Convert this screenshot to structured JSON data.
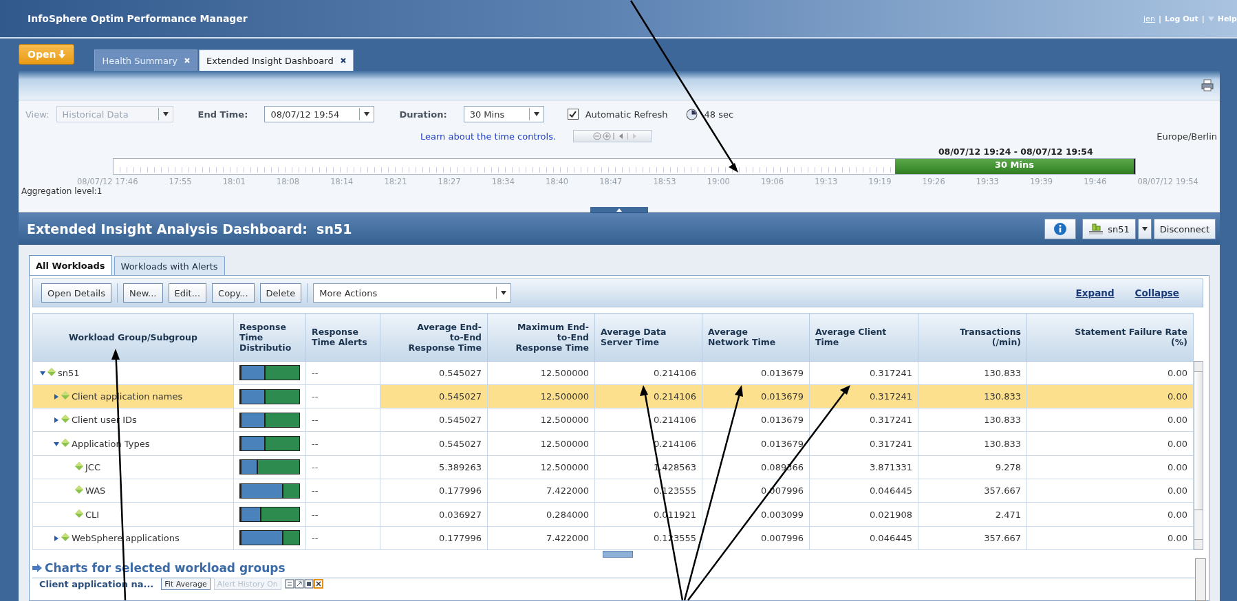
{
  "app": {
    "title": "InfoSphere Optim Performance Manager",
    "user": "jen",
    "links": [
      {
        "separator": "|",
        "label": "Log Out"
      },
      {
        "separator": "|",
        "label": "Help"
      }
    ]
  },
  "open_button": "Open",
  "tabs": [
    {
      "label": "Health Summary",
      "selected": false
    },
    {
      "label": "Extended Insight Dashboard",
      "selected": true
    }
  ],
  "time_controls": {
    "view_label": "View:",
    "view_value": "Historical Data",
    "view_disabled": true,
    "end_time_label": "End Time:",
    "end_time": "08/07/12 19:54",
    "duration_label": "Duration:",
    "duration": "30 Mins",
    "auto_refresh": {
      "label": "Automatic Refresh",
      "checked": true
    },
    "refresh_countdown": "48 sec",
    "help_link": "Learn about the time controls.",
    "timezone": "Europe/Berlin",
    "range": "08/07/12 19:24 - 08/07/12 19:54",
    "selection": {
      "label": "30 Mins",
      "level": 0.235
    },
    "ticks": [
      "08/07/12 17:46",
      "17:55",
      "18:01",
      "18:08",
      "18:14",
      "18:21",
      "18:27",
      "18:34",
      "18:40",
      "18:47",
      "18:53",
      "19:00",
      "19:06",
      "19:13",
      "19:19",
      "19:26",
      "19:33",
      "19:39",
      "19:46",
      "08/07/12 19:54"
    ],
    "aggregation": "Aggregation level:1"
  },
  "dashboard": {
    "title": "Extended Insight Analysis Dashboard:  sn51",
    "database": "sn51",
    "disconnect": "Disconnect"
  },
  "workload_tabs": [
    {
      "label": "All Workloads",
      "selected": true
    },
    {
      "label": "Workloads with Alerts",
      "selected": false
    }
  ],
  "toolbar": {
    "buttons": [
      "Open Details",
      "New...",
      "Edit...",
      "Copy...",
      "Delete"
    ],
    "more_actions": "More Actions",
    "links": [
      "Expand",
      "Collapse"
    ]
  },
  "table": {
    "columns": [
      "Workload Group/Subgroup",
      "Response Time Distributio",
      "Response Time Alerts",
      "Average End-to-End Response Time",
      "Maximum End-to-End Response Time",
      "Average Data Server Time",
      "Average Network Time",
      "Average Client Time",
      "Transactions (/min)",
      "Statement Failure Rate (%)"
    ],
    "rows": [
      {
        "name": "sn51",
        "expanded": true,
        "selected": false,
        "distribution": {
          "level": 0.42
        },
        "alerts": "--",
        "values": [
          "0.545027",
          "12.500000",
          "0.214106",
          "0.013679",
          "0.317241",
          "130.833",
          "0.00"
        ],
        "children": [
          {
            "name": "Client application names",
            "expanded": false,
            "selected": true,
            "distribution": {
              "level": 0.42
            },
            "alerts": "--",
            "values": [
              "0.545027",
              "12.500000",
              "0.214106",
              "0.013679",
              "0.317241",
              "130.833",
              "0.00"
            ]
          },
          {
            "name": "Client user IDs",
            "expanded": false,
            "selected": false,
            "distribution": {
              "level": 0.42
            },
            "alerts": "--",
            "values": [
              "0.545027",
              "12.500000",
              "0.214106",
              "0.013679",
              "0.317241",
              "130.833",
              "0.00"
            ]
          },
          {
            "name": "Application Types",
            "expanded": true,
            "selected": false,
            "distribution": {
              "level": 0.42
            },
            "alerts": "--",
            "values": [
              "0.545027",
              "12.500000",
              "0.214106",
              "0.013679",
              "0.317241",
              "130.833",
              "0.00"
            ],
            "children": [
              {
                "name": "JCC",
                "selected": false,
                "distribution": {
                  "level": 0.28
                },
                "alerts": "--",
                "values": [
                  "5.389263",
                  "12.500000",
                  "1.428563",
                  "0.089366",
                  "3.871331",
                  "9.278",
                  "0.00"
                ]
              },
              {
                "name": "WAS",
                "selected": false,
                "distribution": {
                  "level": 0.73
                },
                "alerts": "--",
                "values": [
                  "0.177996",
                  "7.422000",
                  "0.123555",
                  "0.007996",
                  "0.046445",
                  "357.667",
                  "0.00"
                ]
              },
              {
                "name": "CLI",
                "selected": false,
                "distribution": {
                  "level": 0.35
                },
                "alerts": "--",
                "values": [
                  "0.036927",
                  "0.284000",
                  "0.011921",
                  "0.003099",
                  "0.021908",
                  "2.471",
                  "0.00"
                ]
              }
            ]
          },
          {
            "name": "WebSphere applications",
            "expanded": false,
            "selected": false,
            "distribution": {
              "level": 0.73
            },
            "alerts": "--",
            "values": [
              "0.177996",
              "7.422000",
              "0.123555",
              "0.007996",
              "0.046445",
              "357.667",
              "0.00"
            ]
          }
        ]
      }
    ]
  },
  "charts": {
    "title": "Charts for selected workload groups",
    "chart_title": "Client application na...",
    "buttons": [
      {
        "label": "Fit Average",
        "disabled": false
      },
      {
        "label": "Alert History On",
        "disabled": true
      }
    ]
  }
}
